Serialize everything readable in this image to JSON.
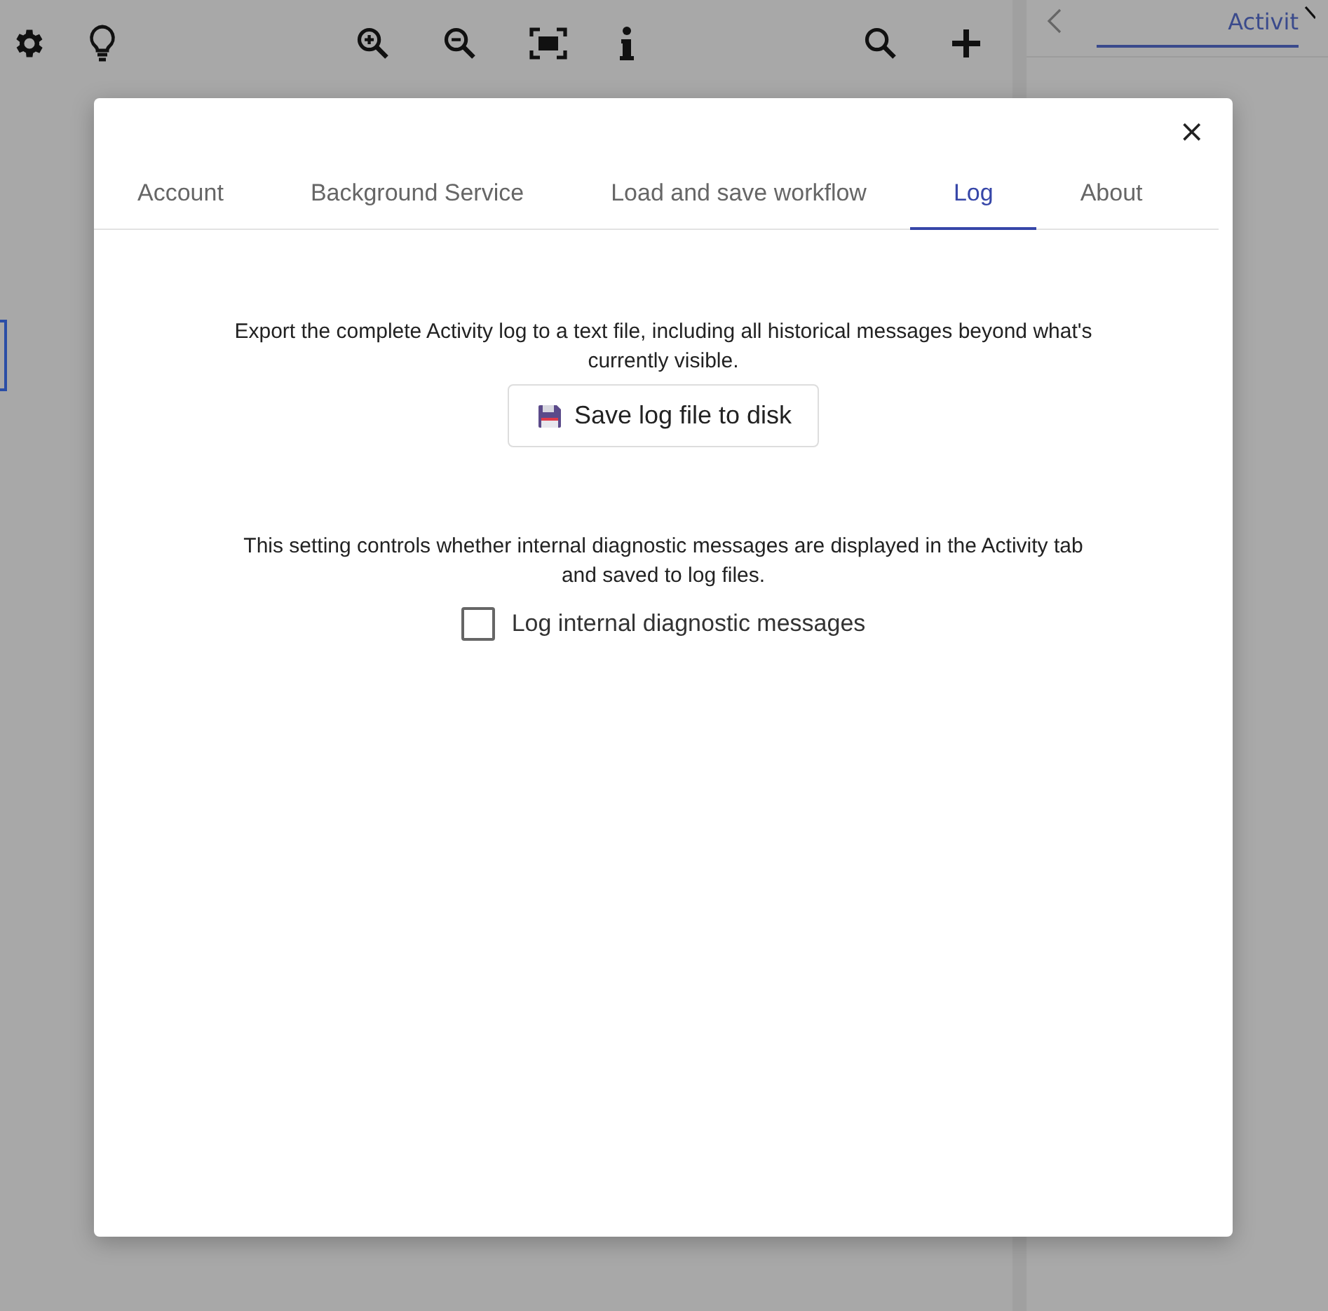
{
  "toolbar": {
    "left": [
      {
        "kind": "settings"
      },
      {
        "kind": "bulb"
      }
    ],
    "middle": [
      {
        "kind": "zoom-in"
      },
      {
        "kind": "zoom-out"
      },
      {
        "kind": "fit"
      },
      {
        "kind": "info"
      }
    ],
    "right": [
      {
        "kind": "search"
      },
      {
        "kind": "add"
      }
    ]
  },
  "side_panel": {
    "tab": "Activit",
    "selected": true
  },
  "dialog": {
    "close": "×",
    "tabs": [
      {
        "label": "Account",
        "selected": false
      },
      {
        "label": "Background Service",
        "selected": false
      },
      {
        "label": "Load and save workflow",
        "selected": false
      },
      {
        "label": "Log",
        "selected": true
      },
      {
        "label": "About",
        "selected": false
      }
    ],
    "export_text": "Export the complete Activity log to a text file, including all historical messages beyond what's currently visible.",
    "save_button": "Save log file to disk",
    "diagnostic_text": "This setting controls whether internal diagnostic messages are displayed in the Activity tab and saved to log files.",
    "diagnostic_checkbox": {
      "label": "Log internal diagnostic messages",
      "checked": false
    }
  }
}
